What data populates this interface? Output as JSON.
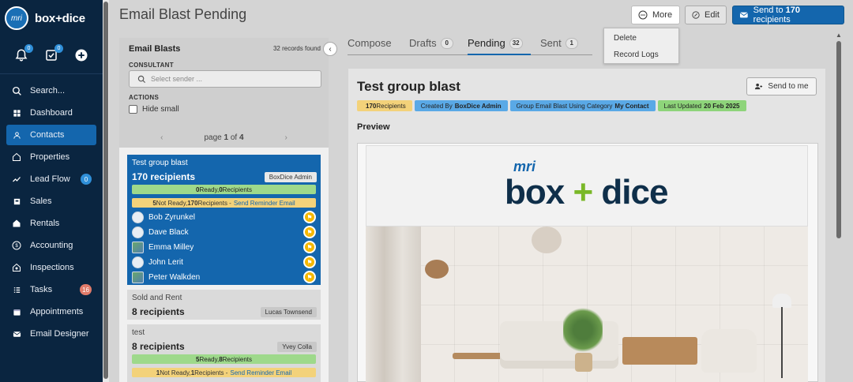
{
  "app": {
    "brand": "box+dice",
    "logo_mark": "mri"
  },
  "header_icons": {
    "notifications_count": "0",
    "tasks_count": "0"
  },
  "sidebar": {
    "items": [
      {
        "label": "Search...",
        "icon": "search-icon"
      },
      {
        "label": "Dashboard",
        "icon": "dashboard-icon"
      },
      {
        "label": "Contacts",
        "icon": "contacts-icon",
        "active": true
      },
      {
        "label": "Properties",
        "icon": "home-icon"
      },
      {
        "label": "Lead Flow",
        "icon": "lead-flow-icon",
        "badge": "0",
        "badge_color": "#2f8fd8"
      },
      {
        "label": "Sales",
        "icon": "sales-icon"
      },
      {
        "label": "Rentals",
        "icon": "rentals-icon"
      },
      {
        "label": "Accounting",
        "icon": "accounting-icon"
      },
      {
        "label": "Inspections",
        "icon": "inspections-icon"
      },
      {
        "label": "Tasks",
        "icon": "tasks-icon",
        "badge": "16",
        "badge_color": "#e07b6a"
      },
      {
        "label": "Appointments",
        "icon": "appointments-icon"
      },
      {
        "label": "Email Designer",
        "icon": "email-designer-icon"
      }
    ]
  },
  "page": {
    "title": "Email Blast Pending"
  },
  "toolbar": {
    "more_label": "More",
    "edit_label": "Edit",
    "send_prefix": "Send to ",
    "send_count": "170",
    "send_suffix": " recipients"
  },
  "more_menu": {
    "items": [
      "Delete",
      "Record Logs"
    ]
  },
  "left_panel": {
    "title": "Email Blasts",
    "records_found": "32 records found",
    "consultant_label": "CONSULTANT",
    "select_placeholder": "Select sender ...",
    "actions_label": "ACTIONS",
    "hide_small_label": "Hide small",
    "pager": {
      "prefix": "page ",
      "current": "1",
      "of": " of ",
      "total": "4"
    }
  },
  "blasts": [
    {
      "title": "Test group blast",
      "count_text": "170 recipients",
      "owner": "BoxDice Admin",
      "ready": {
        "count": "0",
        "mid": " Ready, ",
        "recips": "0",
        "suffix": " Recipients"
      },
      "not_ready": {
        "count": "5",
        "mid": " Not Ready, ",
        "recips": "170",
        "suffix": " Recipients - ",
        "link": "Send Reminder Email"
      },
      "recipients": [
        {
          "name": "Bob Zyrunkel",
          "avatar": "default"
        },
        {
          "name": "Dave Black",
          "avatar": "default"
        },
        {
          "name": "Emma Milley",
          "avatar": "image"
        },
        {
          "name": "John Lerit",
          "avatar": "default"
        },
        {
          "name": "Peter Walkden",
          "avatar": "image"
        }
      ]
    },
    {
      "title": "Sold and Rent",
      "count_text": "8 recipients",
      "owner": "Lucas Townsend"
    },
    {
      "title": "test",
      "count_text": "8 recipients",
      "owner": "Yvey Colla",
      "ready": {
        "count": "5",
        "mid": " Ready, ",
        "recips": "8",
        "suffix": " Recipients"
      },
      "not_ready": {
        "count": "1",
        "mid": " Not Ready, ",
        "recips": "1",
        "suffix": " Recipients - ",
        "link": "Send Reminder Email"
      }
    }
  ],
  "tabs": [
    {
      "label": "Compose",
      "count": ""
    },
    {
      "label": "Drafts",
      "count": "0"
    },
    {
      "label": "Pending",
      "count": "32",
      "active": true
    },
    {
      "label": "Sent",
      "count": "1"
    }
  ],
  "preview": {
    "title": "Test group blast",
    "send_to_me": "Send to me",
    "section_label": "Preview",
    "chips": [
      {
        "prefix": "170",
        "text": " Recipients",
        "color": "#f3d27a"
      },
      {
        "prefix": "Created By ",
        "bold": "BoxDice Admin",
        "color": "#5aa9e6"
      },
      {
        "prefix": "Group Email Blast Using Category ",
        "bold": "My Contact",
        "color": "#5aa9e6"
      },
      {
        "prefix": "Last Updated ",
        "bold": "20 Feb 2025",
        "color": "#8ed47a"
      }
    ]
  },
  "email_brand": {
    "mri": "mri",
    "box": "box",
    "plus": "+",
    "dice": "dice"
  },
  "colors": {
    "sidebar": "#0a2540",
    "primary": "#1466ad",
    "ready": "#9ed98b",
    "not_ready": "#f3d27a"
  }
}
